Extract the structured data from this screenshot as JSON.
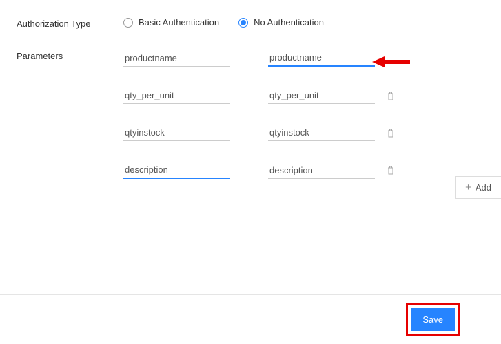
{
  "auth": {
    "label": "Authorization Type",
    "options": {
      "basic": "Basic Authentication",
      "none": "No Authentication"
    }
  },
  "params": {
    "label": "Parameters",
    "rows": [
      {
        "left": "productname",
        "right": "productname"
      },
      {
        "left": "qty_per_unit",
        "right": "qty_per_unit"
      },
      {
        "left": "qtyinstock",
        "right": "qtyinstock"
      },
      {
        "left": "description",
        "right": "description"
      }
    ]
  },
  "add_label": "Add",
  "save_label": "Save"
}
